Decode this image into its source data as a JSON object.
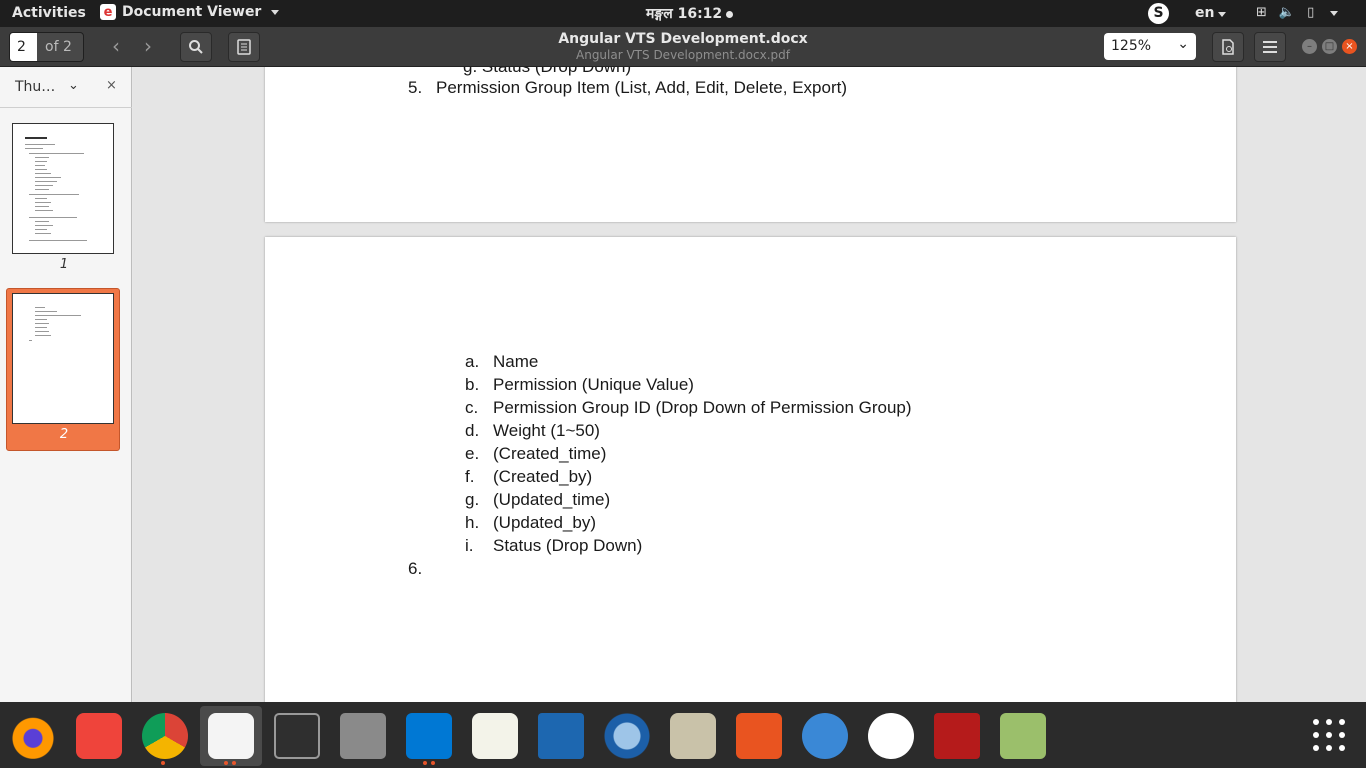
{
  "topbar": {
    "activities": "Activities",
    "app_name": "Document Viewer",
    "clock": "मङ्गल 16:12",
    "skype_label": "S",
    "lang": "en"
  },
  "header": {
    "page_input": "2",
    "page_of": "of 2",
    "title": "Angular VTS Development.docx",
    "subtitle": "Angular VTS Development.docx.pdf",
    "zoom": "125%"
  },
  "sidebar": {
    "label": "Thu…",
    "close": "×",
    "thumbs": [
      {
        "label": "1"
      },
      {
        "label": "2"
      }
    ]
  },
  "document": {
    "page1_partial": "g.  Status (Drop Down)",
    "item5_num": "5.",
    "item5_text": "Permission Group Item (List, Add, Edit, Delete, Export)",
    "subitems": [
      {
        "marker": "a.",
        "text": "Name"
      },
      {
        "marker": "b.",
        "text": "Permission (Unique Value)"
      },
      {
        "marker": "c.",
        "text": "Permission Group ID (Drop Down of Permission Group)"
      },
      {
        "marker": "d.",
        "text": "Weight (1~50)"
      },
      {
        "marker": "e.",
        "text": "(Created_time)"
      },
      {
        "marker": "f.",
        "text": "(Created_by)"
      },
      {
        "marker": "g.",
        "text": "(Updated_time)"
      },
      {
        "marker": "h.",
        "text": "(Updated_by)"
      },
      {
        "marker": "i.",
        "text": "Status (Drop Down)"
      }
    ],
    "item6_num": "6."
  },
  "dock": {
    "apps": [
      "firefox-icon",
      "anydesk-icon",
      "chrome-icon",
      "document-viewer-icon",
      "terminal-icon",
      "files-icon",
      "vscode-icon",
      "text-editor-icon",
      "libreoffice-impress-icon",
      "thunderbird-icon",
      "rhythmbox-icon",
      "software-center-icon",
      "help-icon",
      "mongodb-compass-icon",
      "filezilla-icon",
      "system-monitor-icon"
    ]
  },
  "colors": {
    "accent": "#f07746",
    "topbar": "#1e1e1e",
    "headerbar": "#3c3c3c",
    "dock": "#2b2b2b"
  }
}
